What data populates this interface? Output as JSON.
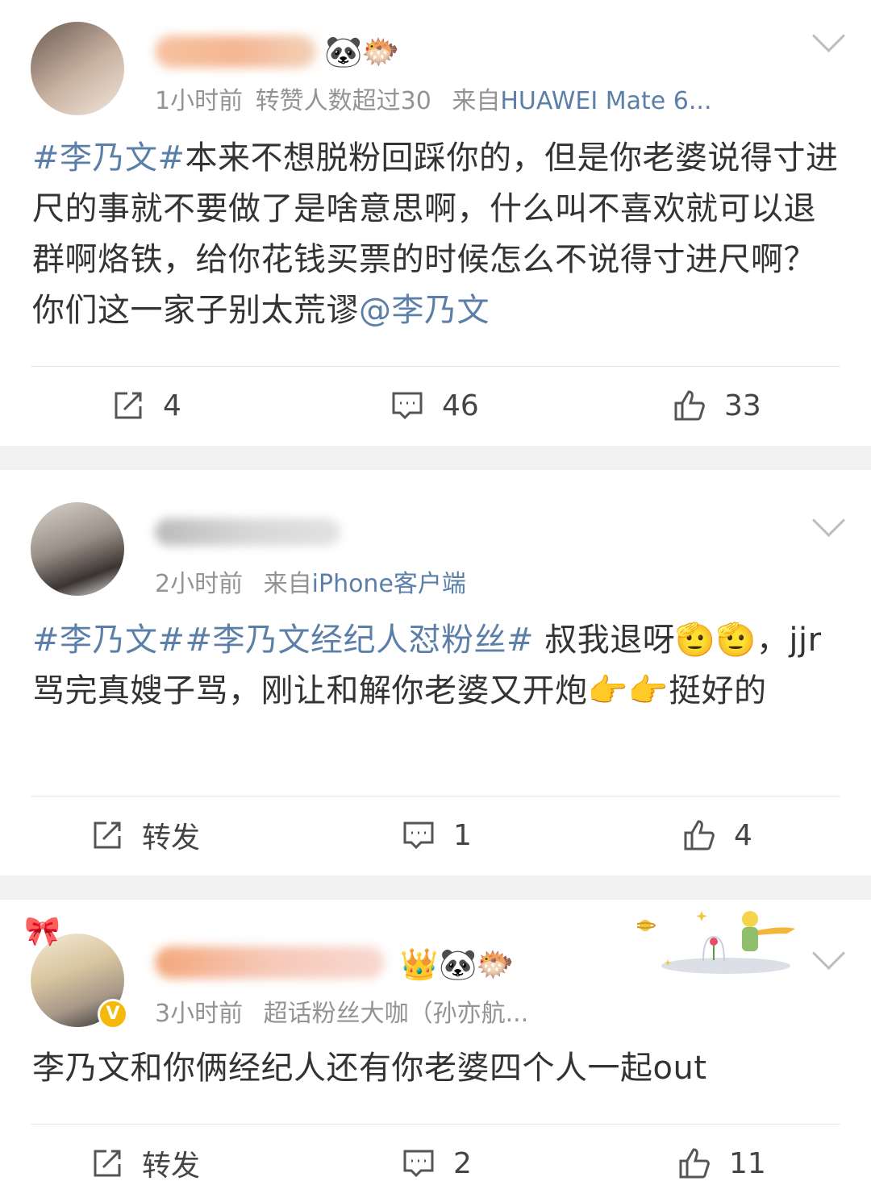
{
  "posts": [
    {
      "time": "1小时前",
      "extra": "转赞人数超过30",
      "source_prefix": "来自",
      "source": "HUAWEI Mate 6...",
      "text_parts": [
        {
          "t": "#李乃文#",
          "link": true
        },
        {
          "t": "本来不想脱粉回踩你的，但是你老婆说得寸进尺的事就不要做了是啥意思啊，什么叫不喜欢就可以退群啊烙铁，给你花钱买票的时候怎么不说得寸进尺啊？你们这一家子别太荒谬",
          "link": false
        },
        {
          "t": "@李乃文",
          "link": true
        }
      ],
      "repost": "4",
      "comments": "46",
      "likes": "33"
    },
    {
      "time": "2小时前",
      "source_prefix": "来自",
      "source": "iPhone客户端",
      "text_parts": [
        {
          "t": "#李乃文##李乃文经纪人怼粉丝#",
          "link": true
        },
        {
          "t": " 叔我退呀🫡🫡，jjr骂完真嫂子骂，刚让和解你老婆又开炮👉👉挺好的",
          "link": false
        }
      ],
      "repost": "转发",
      "comments": "1",
      "likes": "4"
    },
    {
      "time": "3小时前",
      "extra": "超话粉丝大咖（孙亦航...",
      "text_parts": [
        {
          "t": "李乃文和你俩经纪人还有你老婆四个人一起out",
          "link": false
        }
      ],
      "repost": "转发",
      "comments": "2",
      "likes": "11"
    }
  ],
  "colors": {
    "link": "#5b7fa8",
    "meta": "#939393",
    "text": "#333333",
    "gap": "#f1f1f1"
  },
  "icons": {
    "repost": "repost-icon",
    "comment": "comment-icon",
    "like": "like-icon",
    "more": "chevron-down-icon"
  }
}
